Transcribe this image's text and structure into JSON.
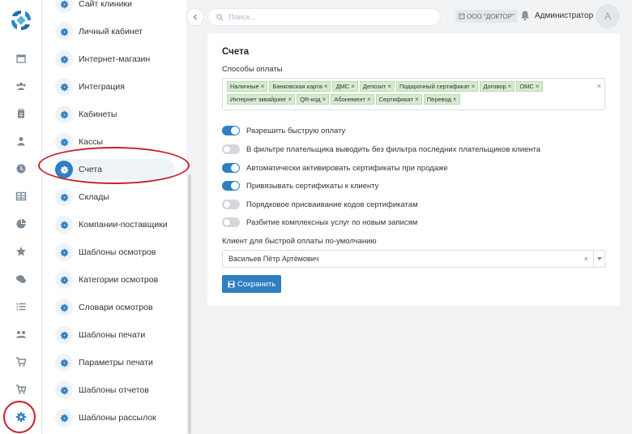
{
  "colors": {
    "accent": "#2f7fc1",
    "tag_bg": "#d6ebd0",
    "annotation": "#c8202a"
  },
  "rail": {
    "icons": [
      "calendar-icon",
      "users-icon",
      "clipboard-icon",
      "user-icon",
      "clock-icon",
      "table-icon",
      "pie-chart-icon",
      "star-icon",
      "chat-icon",
      "list-icon",
      "group-icon",
      "cart-icon",
      "cart-add-icon",
      "gear-icon"
    ]
  },
  "submenu": {
    "items": [
      {
        "label": "Сайт клиники"
      },
      {
        "label": "Личный кабинет"
      },
      {
        "label": "Интернет-магазин"
      },
      {
        "label": "Интеграция"
      },
      {
        "label": "Кабинеты"
      },
      {
        "label": "Кассы"
      },
      {
        "label": "Счета"
      },
      {
        "label": "Склады"
      },
      {
        "label": "Компании-поставщики"
      },
      {
        "label": "Шаблоны осмотров"
      },
      {
        "label": "Категории осмотров"
      },
      {
        "label": "Словари осмотров"
      },
      {
        "label": "Шаблоны печати"
      },
      {
        "label": "Параметры печати"
      },
      {
        "label": "Шаблоны отчетов"
      },
      {
        "label": "Шаблоны рассылок"
      }
    ],
    "active": "Счета"
  },
  "topbar": {
    "search_placeholder": "Поиск...",
    "organization": "ООО \"ДОКТОР\"",
    "user_name": "Администратор",
    "avatar_letter": "А"
  },
  "card": {
    "title": "Счета",
    "payment_methods_label": "Способы оплаты",
    "payment_methods": [
      "Наличные",
      "Банковская карта",
      "ДМС",
      "Депозит",
      "Подарочный сертификат",
      "Договор",
      "ОМС",
      "Интернет эквайринг",
      "QR-код",
      "Абонемент",
      "Сертификат",
      "Перевод"
    ],
    "toggles": [
      {
        "label": "Разрешить быструю оплату",
        "on": true
      },
      {
        "label": "В фильтре плательщика выводить без фильтра последних плательщиков клиента",
        "on": false
      },
      {
        "label": "Автоматически активировать сертификаты при продаже",
        "on": true
      },
      {
        "label": "Привязывать сертификаты к клиенту",
        "on": true
      },
      {
        "label": "Порядковое присваивание кодов сертификатам",
        "on": false
      },
      {
        "label": "Разбитие комплексных услуг по новым записям",
        "on": false
      }
    ],
    "default_client_label": "Клиент для быстрой оплаты по-умолчанию",
    "default_client_value": "Васильев Пётр Артёмович",
    "save_label": "Сохранить"
  }
}
